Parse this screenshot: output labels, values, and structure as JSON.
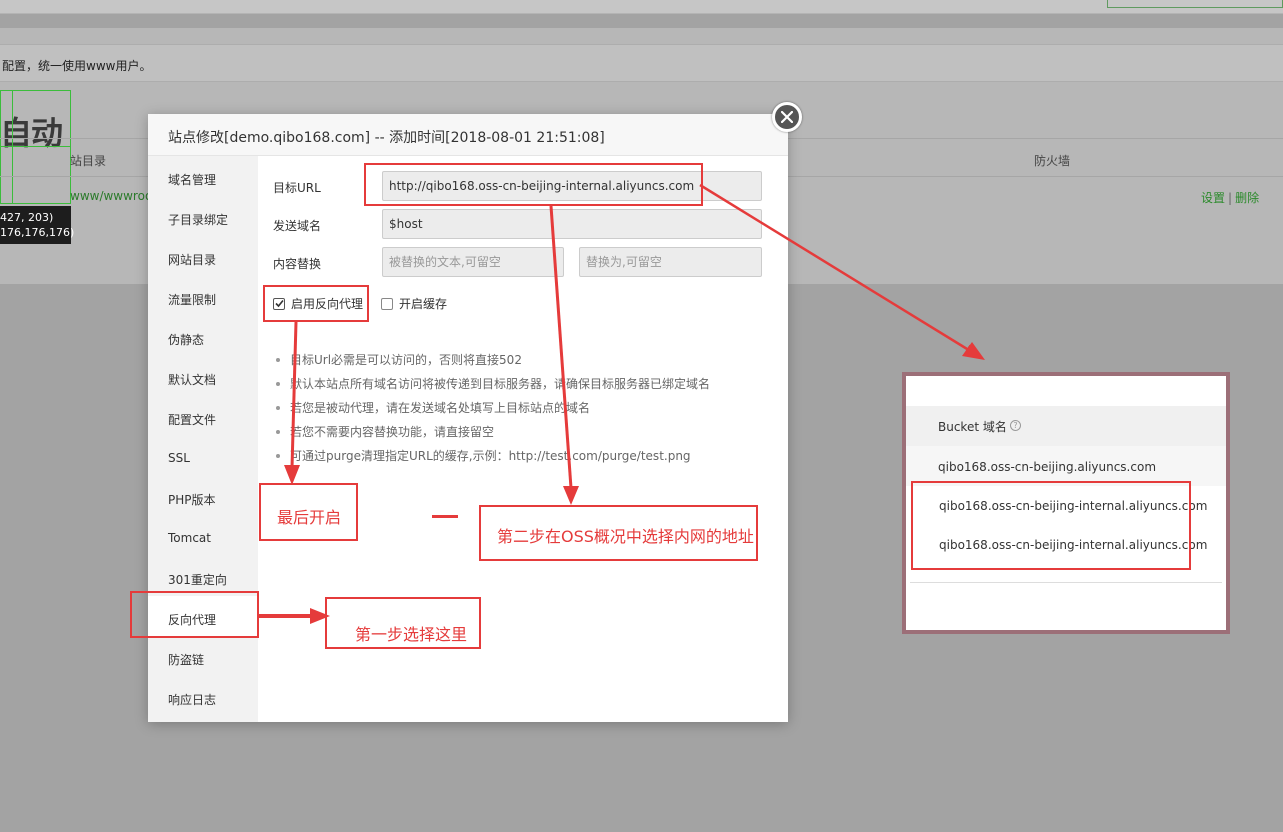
{
  "background": {
    "notice": "配置，统一使用www用户。",
    "big_title": "自动",
    "col_dir": "站目录",
    "col_firewall": "防火墙",
    "row_path": "www/wwwroo",
    "row_action_settings": "设置",
    "row_action_sep": "|",
    "row_action_delete": "删除",
    "tooltip_line1": "427, 203)",
    "tooltip_line2": "176,176,176)"
  },
  "modal": {
    "title": "站点修改[demo.qibo168.com] -- 添加时间[2018-08-01 21:51:08]",
    "sidebar": [
      "域名管理",
      "子目录绑定",
      "网站目录",
      "流量限制",
      "伪静态",
      "默认文档",
      "配置文件",
      "SSL",
      "PHP版本",
      "Tomcat",
      "301重定向",
      "反向代理",
      "防盗链",
      "响应日志"
    ],
    "active_index": 11,
    "form": {
      "target_url_label": "目标URL",
      "target_url_value": "http://qibo168.oss-cn-beijing-internal.aliyuncs.com",
      "send_domain_label": "发送域名",
      "send_domain_value": "$host",
      "replace_label": "内容替换",
      "replace_from_placeholder": "被替换的文本,可留空",
      "replace_to_placeholder": "替换为,可留空",
      "enable_proxy_label": "启用反向代理",
      "enable_proxy_checked": true,
      "enable_cache_label": "开启缓存",
      "enable_cache_checked": false
    },
    "tips": [
      "目标Url必需是可以访问的，否则将直接502",
      "默认本站点所有域名访问将被传递到目标服务器，请确保目标服务器已绑定域名",
      "若您是被动代理，请在发送域名处填写上目标站点的域名",
      "若您不需要内容替换功能，请直接留空",
      "可通过purge清理指定URL的缓存,示例：http://test.com/purge/test.png"
    ]
  },
  "oss_panel": {
    "header": "Bucket 域名",
    "help_icon": "?",
    "rows": [
      "qibo168.oss-cn-beijing.aliyuncs.com",
      "qibo168.oss-cn-beijing-internal.aliyuncs.com",
      "qibo168.oss-cn-beijing-internal.aliyuncs.com"
    ]
  },
  "annotations": {
    "last_enable": "最后开启",
    "step2": "第二步在OSS概况中选择内网的地址",
    "step1": "第一步选择这里",
    "color": "#e53b3b"
  }
}
